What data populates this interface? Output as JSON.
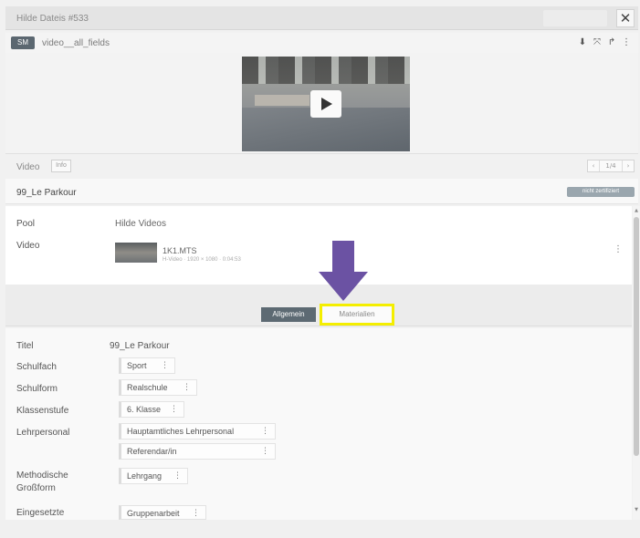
{
  "dialog": {
    "title": "Hilde Dateis #533",
    "close_glyph": "✕"
  },
  "field": {
    "type_badge": "SM",
    "name": "video__all_fields",
    "tool_icons": [
      "download-icon",
      "expand-icon",
      "share-icon",
      "more-icon"
    ],
    "tool_glyphs": [
      "⬇",
      "⤧",
      "↱",
      "⋮"
    ]
  },
  "video_row": {
    "label": "Video",
    "info_label": "Info",
    "pager_prev": "‹",
    "pager_value": "1/4",
    "pager_next": "›"
  },
  "record": {
    "name": "99_Le Parkour",
    "status": "nicht zertifiziert"
  },
  "properties": {
    "pool_label": "Pool",
    "pool_value": "Hilde Videos",
    "video_label": "Video",
    "video_title": "1K1.MTS",
    "video_meta": "H-Video · 1920 × 1080 · 0:04:53",
    "kebab": "⋮"
  },
  "tabs": {
    "allgemein": "Allgemein",
    "materialien": "Materialien"
  },
  "form": {
    "title_label": "Titel",
    "title_value": "99_Le Parkour",
    "schulfach_label": "Schulfach",
    "schulfach_value": "Sport",
    "schulform_label": "Schulform",
    "schulform_value": "Realschule",
    "klassenstufe_label": "Klassenstufe",
    "klassenstufe_value": "6. Klasse",
    "lehrpersonal_label": "Lehrpersonal",
    "lehrpersonal_values": [
      "Hauptamtliches Lehrpersonal",
      "Referendar/in"
    ],
    "methodische_label_1": "Methodische",
    "methodische_label_2": "Großform",
    "methodische_value": "Lehrgang",
    "eingesetzte_label": "Eingesetzte",
    "eingesetzte_value": "Gruppenarbeit",
    "tag_kebab": "⋮"
  },
  "colors": {
    "annotation_arrow": "#6b52a3",
    "highlight_border": "#f4ee00",
    "active_tab": "#5d6a73"
  }
}
